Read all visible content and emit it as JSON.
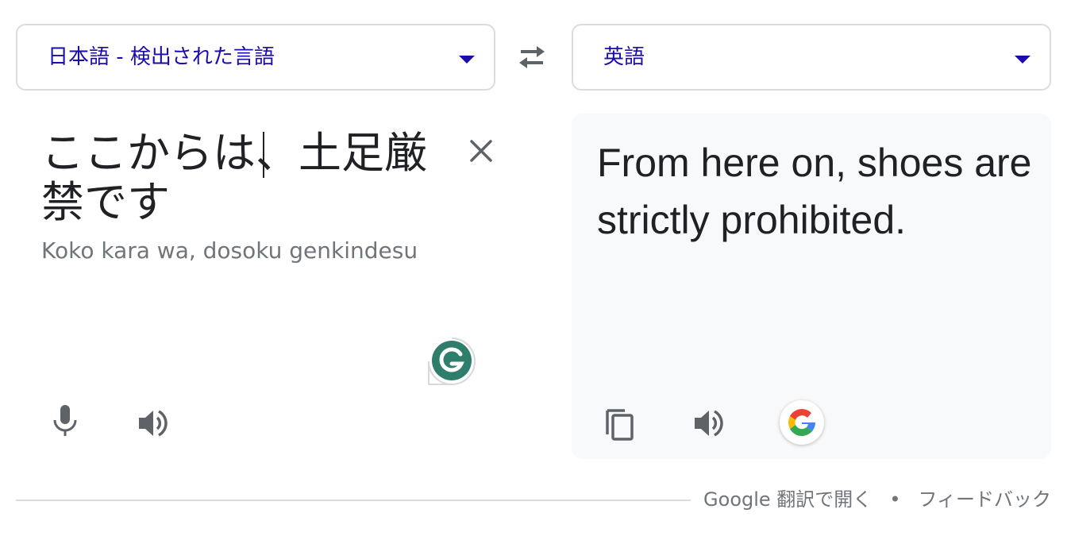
{
  "source_language": {
    "label": "日本語 - 検出された言語"
  },
  "target_language": {
    "label": "英語"
  },
  "source": {
    "text": "ここからは、土足厳禁です",
    "romanization": "Koko kara wa, dosoku genkindesu"
  },
  "result": {
    "text": "From here on, shoes are strictly prohibited."
  },
  "footer": {
    "open_link": "Google 翻訳で開く",
    "separator": "•",
    "feedback_link": "フィードバック"
  },
  "colors": {
    "link_blue": "#1a0dab",
    "text": "#202124",
    "secondary_text": "#70757a",
    "icon_gray": "#5f6368",
    "result_bg": "#f8f9fa",
    "grammarly_green": "#15c39a",
    "border": "#dadce0"
  },
  "icons": {
    "swap": "swap-arrows-icon",
    "clear": "close-icon",
    "mic": "microphone-icon",
    "speaker": "speaker-icon",
    "copy": "copy-icon",
    "google": "google-g-icon",
    "grammarly": "grammarly-icon"
  }
}
